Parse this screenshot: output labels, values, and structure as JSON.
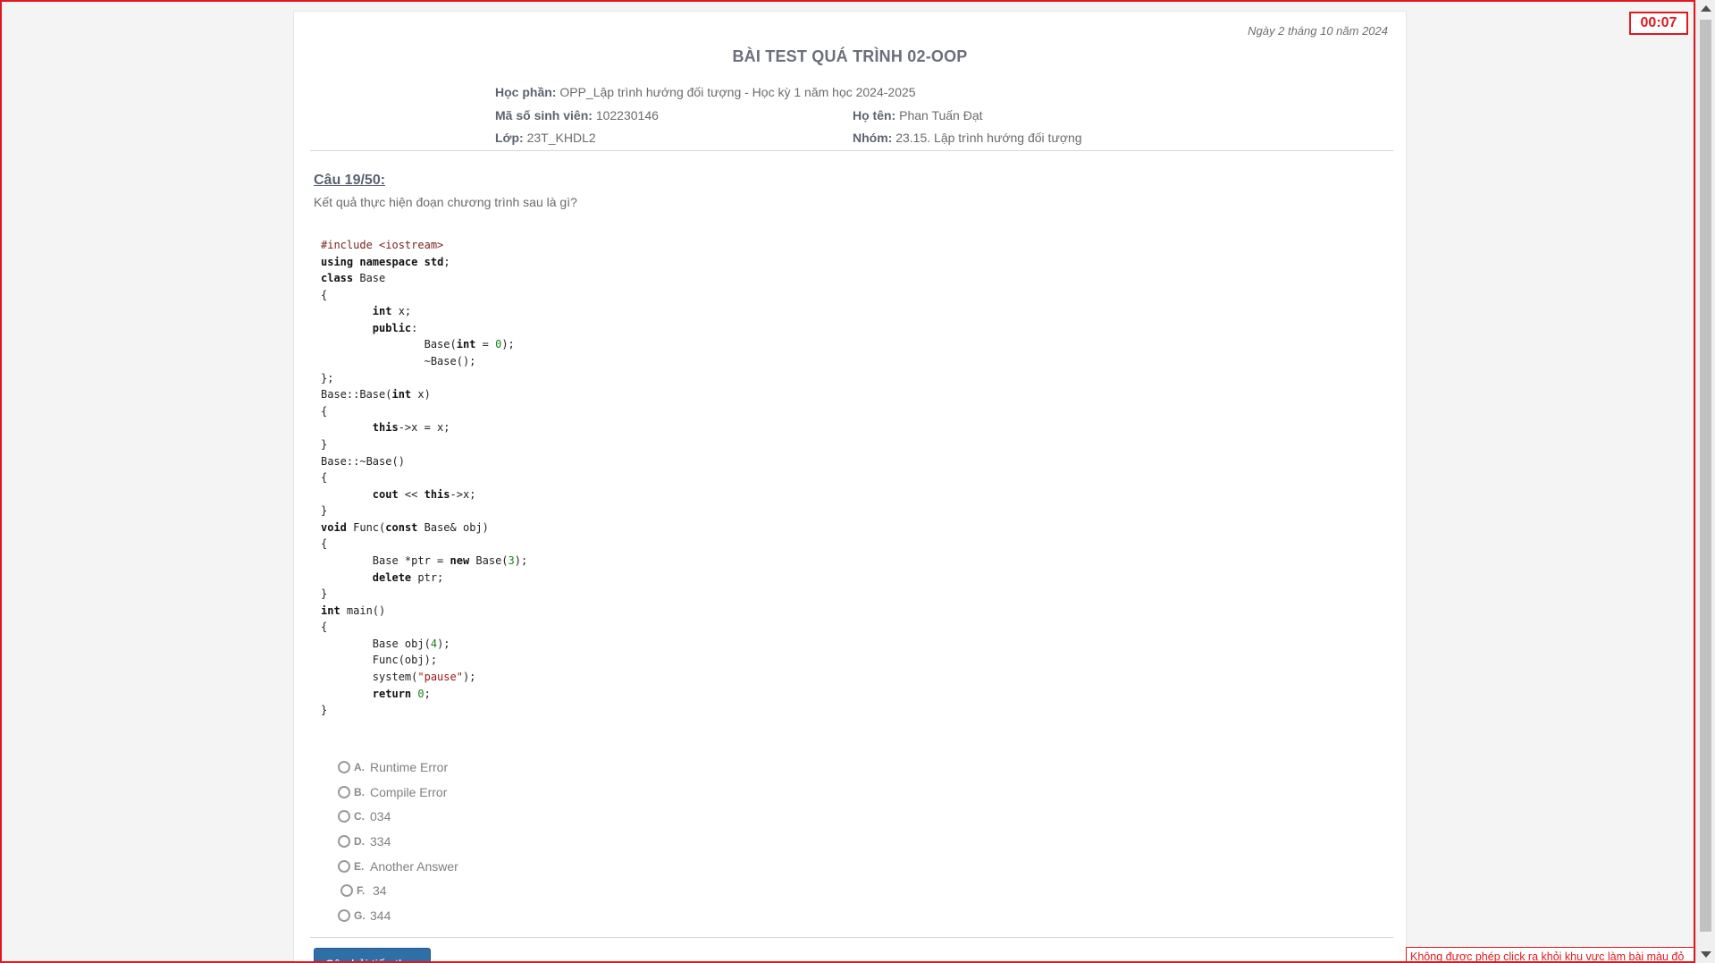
{
  "header": {
    "date": "Ngày 2 tháng 10 năm 2024",
    "title": "BÀI TEST QUÁ TRÌNH 02-OOP",
    "course_label": "Học phần:",
    "course_value": "OPP_Lập trình hướng đối tượng - Học kỳ 1 năm học 2024-2025",
    "student_id_label": "Mã số sinh viên:",
    "student_id_value": "102230146",
    "name_label": "Họ tên:",
    "name_value": "Phan Tuấn Đạt",
    "class_label": "Lớp:",
    "class_value": "23T_KHDL2",
    "group_label": "Nhóm:",
    "group_value": "23.15. Lập trình hướng đối tượng"
  },
  "question": {
    "number": "Câu 19/50:",
    "text": "Kết quả thực hiện đoạn chương trình sau là gì?",
    "code_lines": [
      "#include <iostream>",
      "using namespace std;",
      "class Base",
      "{",
      "        int x;",
      "        public:",
      "                Base(int = 0);",
      "                ~Base();",
      "};",
      "Base::Base(int x)",
      "{",
      "        this->x = x;",
      "}",
      "Base::~Base()",
      "{",
      "        cout << this->x;",
      "}",
      "void Func(const Base& obj)",
      "{",
      "        Base *ptr = new Base(3);",
      "        delete ptr;",
      "}",
      "int main()",
      "{",
      "        Base obj(4);",
      "        Func(obj);",
      "        system(\"pause\");",
      "        return 0;",
      "}"
    ]
  },
  "options": [
    {
      "letter": "A.",
      "text": "Runtime Error"
    },
    {
      "letter": "B.",
      "text": "Compile Error"
    },
    {
      "letter": "C.",
      "text": "034"
    },
    {
      "letter": "D.",
      "text": "334"
    },
    {
      "letter": "E.",
      "text": "Another Answer"
    },
    {
      "letter": "F.",
      "text": "34"
    },
    {
      "letter": "G.",
      "text": "344"
    }
  ],
  "actions": {
    "next_label": "Câu hỏi tiếp theo"
  },
  "timer": {
    "value": "00:07"
  },
  "warning": {
    "text": "Không được phép click ra khỏi khu vực làm bài màu đỏ"
  },
  "colors": {
    "alert_red": "#e0191f",
    "button_blue": "#2f6fa7"
  }
}
